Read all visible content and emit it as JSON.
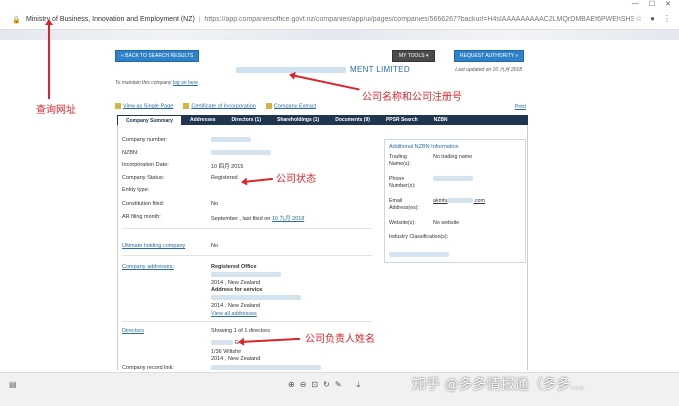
{
  "browser": {
    "site_label": "Ministry of Business, Innovation and Employment (NZ)",
    "url": "https://app.companiesoffice.govt.nz/companies/app/ui/pages/companies/5666267?backurl=H4sIAAAAAAAAAC2LMQrDMBAEf6PWEhSHSaV...",
    "separator": "|"
  },
  "toolbar": {
    "back_label": "« BACK TO SEARCH RESULTS",
    "my_tools_label": "MY TOOLS ▾",
    "request_authority_label": "REQUEST AUTHORITY »"
  },
  "header": {
    "company_name": "MENT LIMITED",
    "last_updated": "Last updated on 10 九月 2018",
    "maintain_text": "To maintain this company",
    "login_link": "log on here"
  },
  "actions": {
    "view_single_page": "View as Single Page",
    "certificate": "Certificate of Incorporation",
    "extract": "Company Extract",
    "print": "Print"
  },
  "tabs": [
    {
      "label": "Company Summary"
    },
    {
      "label": "Addresses"
    },
    {
      "label": "Directors (1)"
    },
    {
      "label": "Shareholdings (1)"
    },
    {
      "label": "Documents (9)"
    },
    {
      "label": "PPSR Search"
    },
    {
      "label": "NZBN"
    }
  ],
  "summary": {
    "company_number_label": "Company number:",
    "nzbn_label": "NZBN:",
    "incorporation_label": "Incorporation Date:",
    "incorporation_value": "10 四月 2015",
    "status_label": "Company Status:",
    "status_value": "Registered",
    "entity_type_label": "Entity type:",
    "constitution_label": "Constitution filed:",
    "constitution_value": "No",
    "ar_label": "AR filing month:",
    "ar_value": "September , last filed on",
    "ar_date": "10 九月 2018",
    "ultimate_label": "Ultimate holding company",
    "ultimate_value": "No",
    "addresses_label": "Company addresses:",
    "registered_office": "Registered Office",
    "reg_address_line": "2014 , New Zealand",
    "address_for_service": "Address for service",
    "service_address_line": "2014 , New Zealand",
    "view_all_addresses": "View all addresses",
    "directors_label": "Directors",
    "directors_value": "Showing 1 of 1 directors",
    "director_initial": "G",
    "director_address1": "1/36 Wiltshir",
    "director_address2": "2014 , New Zealand",
    "record_link_label": "Company record link:"
  },
  "nzbn_box": {
    "title": "Additional NZBN Information",
    "trading_label": "Trading Name(s):",
    "trading_value": "No trading name",
    "phone_label": "Phone Number(s):",
    "email_label": "Email Address(es):",
    "email_value_a": "akmfu",
    "email_value_b": ".com",
    "website_label": "Website(s):",
    "website_value": "No website",
    "industry_label": "Industry Classification(s):"
  },
  "annotations": {
    "url_note": "查询网址",
    "name_note": "公司名称和公司注册号",
    "status_note": "公司状态",
    "director_note": "公司负责人姓名"
  },
  "footer": {
    "watermark": "知乎 @多多情报通（多多..."
  },
  "colors": {
    "annotation_red": "#d8262b",
    "tab_navy": "#1f3550",
    "button_blue": "#2f82c8",
    "link_blue": "#2a6ea8"
  }
}
